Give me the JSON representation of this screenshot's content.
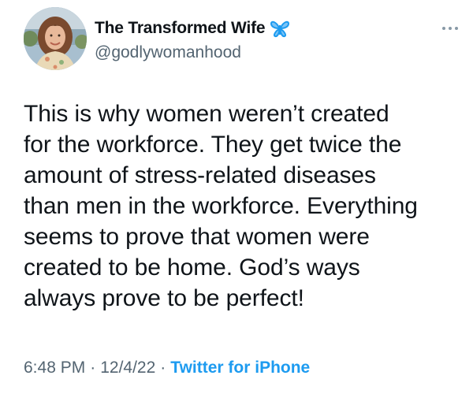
{
  "author": {
    "name": "The Transformed Wife",
    "handle": "@godlywomanhood",
    "badge_icon": "butterfly-icon",
    "badge_color": "#1d9bf0"
  },
  "tweet": {
    "text": "This is why women weren’t created\nfor the workforce. They get twice the\namount of stress-related diseases\nthan men in the workforce. Everything\nseems to prove that women were\ncreated to be home. God’s ways\nalways prove to be perfect!"
  },
  "meta": {
    "time": "6:48 PM",
    "separator": "·",
    "date": "12/4/22",
    "source": "Twitter for iPhone"
  },
  "colors": {
    "text": "#0f1419",
    "secondary": "#536471",
    "accent": "#1d9bf0"
  },
  "icons": {
    "more": "more-options-icon"
  }
}
